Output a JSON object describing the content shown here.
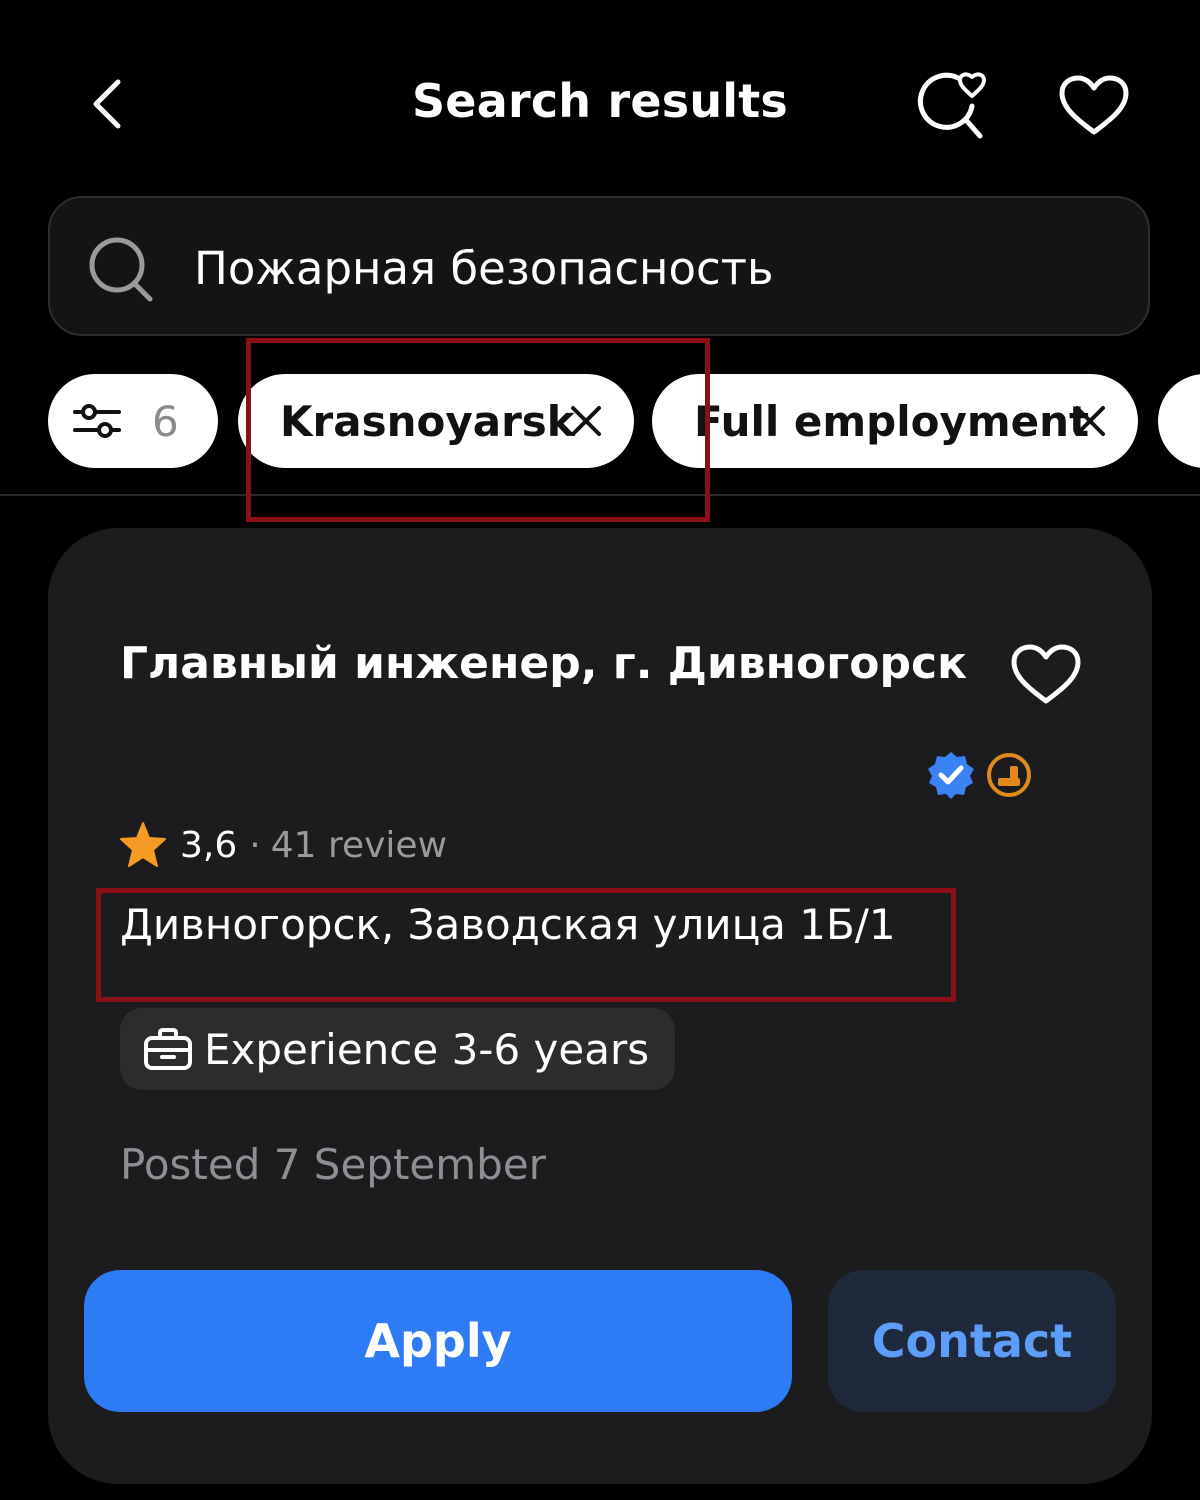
{
  "header": {
    "title": "Search results",
    "back_icon": "chevron-left-icon",
    "saved_search_icon": "search-heart-icon",
    "favorites_icon": "heart-icon"
  },
  "search": {
    "value": "Пожарная безопасность",
    "icon": "search-icon"
  },
  "filters": {
    "icon": "sliders-icon",
    "count": "6",
    "chips": [
      {
        "label": "Krasnoyarsk",
        "removable": true
      },
      {
        "label": "Full employment",
        "removable": true
      }
    ]
  },
  "job_card": {
    "title": "Главный инженер, г. Дивногорск",
    "badges": [
      "verified-icon",
      "employer-badge-icon"
    ],
    "rating": "3,6",
    "separator": "·",
    "reviews": "41 review",
    "address": "Дивногорск, Заводская улица 1Б/1",
    "experience": "Experience 3-6 years",
    "posted": "Posted 7 September",
    "apply_label": "Apply",
    "contact_label": "Contact"
  },
  "colors": {
    "background": "#000000",
    "card": "#1c1c1e",
    "accent_blue": "#2d7cf6",
    "contact_bg": "#1e2a3c",
    "contact_text": "#5b9df9",
    "highlight": "#8b0f14",
    "star": "#f59a23",
    "verified": "#3b82f6",
    "employer_badge": "#e08a1c"
  }
}
